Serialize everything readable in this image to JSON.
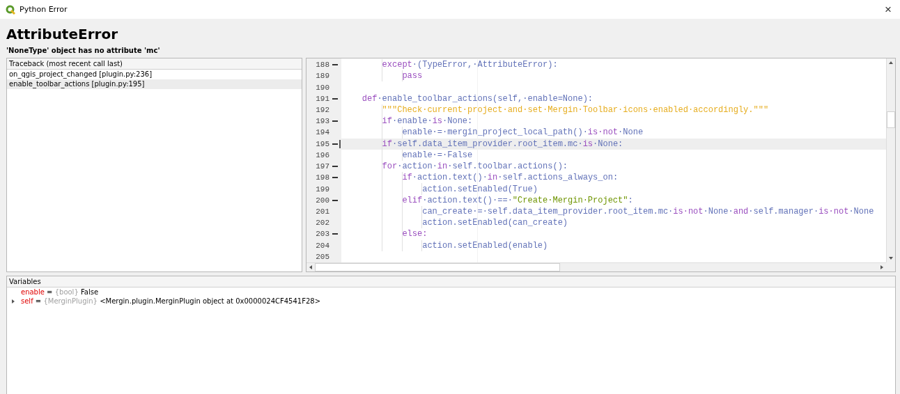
{
  "window": {
    "title": "Python Error",
    "close": "×"
  },
  "error": {
    "type": "AttributeError",
    "message": "'NoneType' object has no attribute 'mc'"
  },
  "traceback": {
    "header": "Traceback (most recent call last)",
    "items": [
      {
        "label": "on_qgis_project_changed [plugin.py:236]",
        "selected": false
      },
      {
        "label": "enable_toolbar_actions [plugin.py:195]",
        "selected": true
      }
    ]
  },
  "code": {
    "lines": [
      {
        "number": "188",
        "fold": true,
        "current": false,
        "tokens": [
          {
            "kind": "keyword",
            "text": "        except"
          },
          {
            "kind": "name",
            "text": "·(TypeError,·AttributeError):"
          }
        ]
      },
      {
        "number": "189",
        "fold": false,
        "current": false,
        "tokens": [
          {
            "kind": "keyword",
            "text": "            pass"
          }
        ]
      },
      {
        "number": "190",
        "fold": false,
        "current": false
      },
      {
        "number": "191",
        "fold": true,
        "current": false,
        "tokens": [
          {
            "kind": "keyword",
            "text": "    def"
          },
          {
            "kind": "name",
            "text": "·enable_toolbar_actions(self,·enable=None):"
          }
        ]
      },
      {
        "number": "192",
        "fold": false,
        "current": false,
        "tokens": [
          {
            "kind": "docstring",
            "text": "        \"\"\"Check·current·project·and·set·Mergin·Toolbar·icons·enabled·accordingly.\"\"\""
          }
        ]
      },
      {
        "number": "193",
        "fold": true,
        "current": false,
        "tokens": [
          {
            "kind": "keyword",
            "text": "        if"
          },
          {
            "kind": "name",
            "text": "·enable·"
          },
          {
            "kind": "keyword",
            "text": "is"
          },
          {
            "kind": "name",
            "text": "·None:"
          }
        ]
      },
      {
        "number": "194",
        "fold": false,
        "current": false,
        "tokens": [
          {
            "kind": "name",
            "text": "            enable·=·mergin_project_local_path()·"
          },
          {
            "kind": "keyword",
            "text": "is·not"
          },
          {
            "kind": "name",
            "text": "·None"
          }
        ]
      },
      {
        "number": "195",
        "fold": true,
        "current": true,
        "tokens": [
          {
            "kind": "keyword",
            "text": "        if"
          },
          {
            "kind": "name",
            "text": "·self.data_item_provider.root_item.mc·"
          },
          {
            "kind": "keyword",
            "text": "is"
          },
          {
            "kind": "name",
            "text": "·None:"
          }
        ]
      },
      {
        "number": "196",
        "fold": false,
        "current": false,
        "tokens": [
          {
            "kind": "name",
            "text": "            enable·=·False"
          }
        ]
      },
      {
        "number": "197",
        "fold": true,
        "current": false,
        "tokens": [
          {
            "kind": "keyword",
            "text": "        for"
          },
          {
            "kind": "name",
            "text": "·action·"
          },
          {
            "kind": "keyword",
            "text": "in"
          },
          {
            "kind": "name",
            "text": "·self.toolbar.actions():"
          }
        ]
      },
      {
        "number": "198",
        "fold": true,
        "current": false,
        "tokens": [
          {
            "kind": "keyword",
            "text": "            if"
          },
          {
            "kind": "name",
            "text": "·action.text()·"
          },
          {
            "kind": "keyword",
            "text": "in"
          },
          {
            "kind": "name",
            "text": "·self.actions_always_on:"
          }
        ]
      },
      {
        "number": "199",
        "fold": false,
        "current": false,
        "tokens": [
          {
            "kind": "name",
            "text": "                action.setEnabled(True)"
          }
        ]
      },
      {
        "number": "200",
        "fold": true,
        "current": false,
        "tokens": [
          {
            "kind": "keyword",
            "text": "            elif"
          },
          {
            "kind": "name",
            "text": "·action.text()·==·"
          },
          {
            "kind": "string",
            "text": "\"Create·Mergin·Project\""
          },
          {
            "kind": "name",
            "text": ":"
          }
        ]
      },
      {
        "number": "201",
        "fold": false,
        "current": false,
        "tokens": [
          {
            "kind": "name",
            "text": "                can_create·=·self.data_item_provider.root_item.mc·"
          },
          {
            "kind": "keyword",
            "text": "is·not"
          },
          {
            "kind": "name",
            "text": "·None·"
          },
          {
            "kind": "keyword",
            "text": "and"
          },
          {
            "kind": "name",
            "text": "·self.manager·"
          },
          {
            "kind": "keyword",
            "text": "is·not"
          },
          {
            "kind": "name",
            "text": "·None"
          }
        ]
      },
      {
        "number": "202",
        "fold": false,
        "current": false,
        "tokens": [
          {
            "kind": "name",
            "text": "                action.setEnabled(can_create)"
          }
        ]
      },
      {
        "number": "203",
        "fold": true,
        "current": false,
        "tokens": [
          {
            "kind": "keyword",
            "text": "            else:"
          }
        ]
      },
      {
        "number": "204",
        "fold": false,
        "current": false,
        "tokens": [
          {
            "kind": "name",
            "text": "                action.setEnabled(enable)"
          }
        ]
      },
      {
        "number": "205",
        "fold": false,
        "current": false
      }
    ]
  },
  "variables": {
    "header": "Variables",
    "items": [
      {
        "name": "enable",
        "equals": "=",
        "type": "{bool}",
        "value": "False",
        "expandable": false
      },
      {
        "name": "self",
        "equals": "=",
        "type": "{MerginPlugin}",
        "value": "<Mergin.plugin.MerginPlugin object at 0x0000024CF4541F28>",
        "expandable": true
      }
    ]
  }
}
